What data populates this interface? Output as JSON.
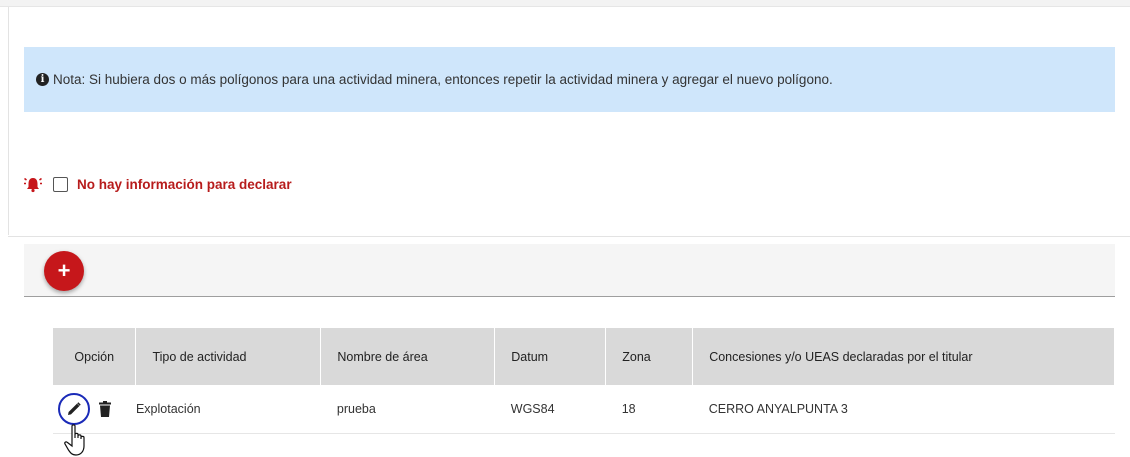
{
  "note": {
    "icon": "info-icon",
    "text": "Nota: Si hubiera dos o más polígonos para una actividad minera, entonces repetir la actividad minera y agregar el nuevo polígono."
  },
  "declare": {
    "icon": "alarm-icon",
    "checked": false,
    "label": "No hay información para declarar",
    "color": "#b71c1c"
  },
  "toolbar": {
    "add_label": "+",
    "add_color": "#c6171b"
  },
  "table": {
    "headers": [
      "Opción",
      "Tipo de actividad",
      "Nombre de área",
      "Datum",
      "Zona",
      "Concesiones y/o UEAS declaradas por el titular"
    ],
    "rows": [
      {
        "actions": [
          "edit-icon",
          "trash-icon"
        ],
        "tipo": "Explotación",
        "nombre": "prueba",
        "datum": "WGS84",
        "zona": "18",
        "concesiones": "CERRO ANYALPUNTA 3"
      }
    ]
  },
  "accent_colors": {
    "note_bg": "#cfe6fb",
    "focus_ring": "#1a2ab8",
    "header_bg": "#d9d9d9"
  }
}
